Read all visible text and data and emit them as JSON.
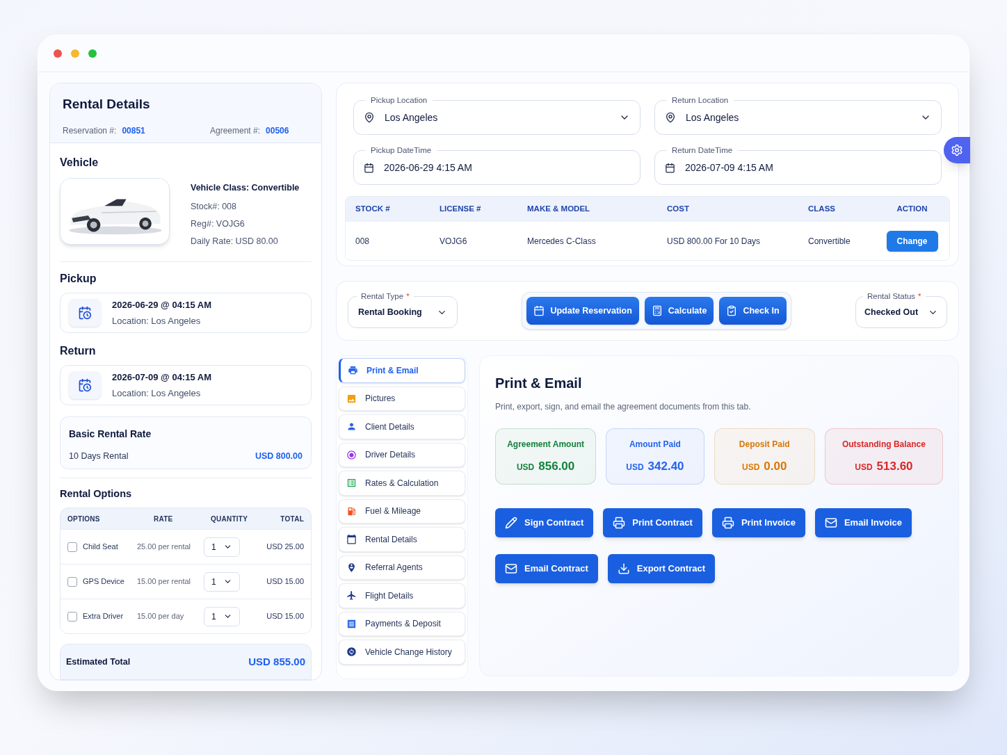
{
  "rental_details": {
    "title": "Rental Details",
    "reservation_label": "Reservation #:",
    "reservation_number": "00851",
    "agreement_label": "Agreement #:",
    "agreement_number": "00506"
  },
  "vehicle": {
    "heading": "Vehicle",
    "class_line": "Vehicle Class: Convertible",
    "details": [
      "Stock#: 008",
      "Reg#: VOJG6",
      "Daily Rate: USD 80.00"
    ]
  },
  "pickup": {
    "heading": "Pickup",
    "datetime": "2026-06-29 @ 04:15 AM",
    "location": "Location: Los Angeles"
  },
  "return": {
    "heading": "Return",
    "datetime": "2026-07-09 @ 04:15 AM",
    "location": "Location: Los Angeles"
  },
  "basic_rate": {
    "title": "Basic Rental Rate",
    "label": "10 Days Rental",
    "amount": "USD 800.00"
  },
  "rental_options": {
    "heading": "Rental Options",
    "columns": [
      "OPTIONS",
      "RATE",
      "QUANTITY",
      "TOTAL"
    ],
    "rows": [
      {
        "name": "Child Seat",
        "checked": false,
        "rate": "25.00 per rental",
        "quantity": "1",
        "total": "USD 25.00"
      },
      {
        "name": "GPS Device",
        "checked": false,
        "rate": "15.00 per rental",
        "quantity": "1",
        "total": "USD 15.00"
      },
      {
        "name": "Extra Driver",
        "checked": false,
        "rate": "15.00 per day",
        "quantity": "1",
        "total": "USD 15.00"
      }
    ]
  },
  "estimated_total": {
    "label": "Estimated Total",
    "amount": "USD 855.00"
  },
  "fields": [
    {
      "label": "Pickup Location",
      "kind": "location",
      "value": "Los Angeles"
    },
    {
      "label": "Return Location",
      "kind": "location",
      "value": "Los Angeles"
    },
    {
      "label": "Pickup DateTime",
      "kind": "datetime",
      "value": "2026-06-29 4:15 AM"
    },
    {
      "label": "Return DateTime",
      "kind": "datetime",
      "value": "2026-07-09 4:15 AM"
    }
  ],
  "vehicles_table": {
    "columns": [
      "STOCK #",
      "LICENSE #",
      "MAKE & MODEL",
      "COST",
      "CLASS",
      "ACTION"
    ],
    "rows": [
      {
        "stock": "008",
        "license": "VOJG6",
        "make_model": "Mercedes C-Class",
        "cost": "USD 800.00 For 10 Days",
        "class": "Convertible",
        "action": "Change"
      }
    ]
  },
  "rental_type": {
    "label": "Rental Type",
    "required_mark": "*",
    "value": "Rental Booking"
  },
  "actions": [
    {
      "label": "Update Reservation",
      "kind": "calendar"
    },
    {
      "label": "Calculate",
      "kind": "calculator"
    },
    {
      "label": "Check In",
      "kind": "checkin"
    }
  ],
  "rental_status": {
    "label": "Rental Status",
    "required_mark": "*",
    "value": "Checked Out"
  },
  "nav": [
    {
      "label": "Print & Email",
      "kind": "print",
      "color": "#2563eb",
      "selected": true
    },
    {
      "label": "Pictures",
      "kind": "pictures",
      "color": "#f59e0b",
      "selected": false
    },
    {
      "label": "Client Details",
      "kind": "client",
      "color": "#2563eb",
      "selected": false
    },
    {
      "label": "Driver Details",
      "kind": "driver",
      "color": "#9333ea",
      "selected": false
    },
    {
      "label": "Rates & Calculation",
      "kind": "rates",
      "color": "#16a34a",
      "selected": false
    },
    {
      "label": "Fuel & Mileage",
      "kind": "fuel",
      "color": "#f4511e",
      "selected": false
    },
    {
      "label": "Rental Details",
      "kind": "rental",
      "color": "#1e3a8a",
      "selected": false
    },
    {
      "label": "Referral Agents",
      "kind": "referral",
      "color": "#1e3a8a",
      "selected": false
    },
    {
      "label": "Flight Details",
      "kind": "flight",
      "color": "#1e3a8a",
      "selected": false
    },
    {
      "label": "Payments & Deposit",
      "kind": "payments",
      "color": "#2563eb",
      "selected": false
    },
    {
      "label": "Vehicle Change History",
      "kind": "history",
      "color": "#1e3a8a",
      "selected": false
    }
  ],
  "panel": {
    "title": "Print & Email",
    "description": "Print, export, sign, and email the agreement documents from this tab.",
    "summary": [
      {
        "label": "Agreement Amount",
        "currency": "USD",
        "amount": "856.00",
        "color": "#15803d"
      },
      {
        "label": "Amount Paid",
        "currency": "USD",
        "amount": "342.40",
        "color": "#2563eb"
      },
      {
        "label": "Deposit Paid",
        "currency": "USD",
        "amount": "0.00",
        "color": "#d97706"
      },
      {
        "label": "Outstanding Balance",
        "currency": "USD",
        "amount": "513.60",
        "color": "#dc2626"
      }
    ],
    "buttons": [
      {
        "label": "Sign Contract",
        "kind": "sign"
      },
      {
        "label": "Print Contract",
        "kind": "print"
      },
      {
        "label": "Print Invoice",
        "kind": "print"
      },
      {
        "label": "Email Invoice",
        "kind": "email"
      },
      {
        "label": "Email Contract",
        "kind": "email"
      },
      {
        "label": "Export Contract",
        "kind": "export"
      }
    ]
  }
}
